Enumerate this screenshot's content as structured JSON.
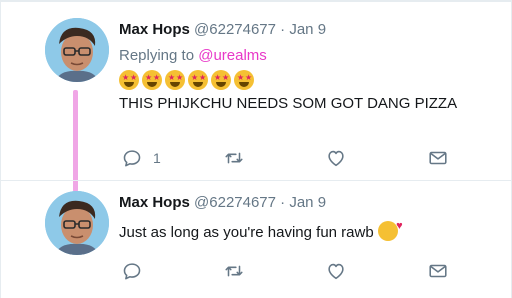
{
  "tweets": [
    {
      "author_name": "Max Hops",
      "author_handle": "@62274677",
      "separator": "·",
      "date": "Jan 9",
      "replying_prefix": "Replying to",
      "replying_to": "@urealms",
      "emoji_count": 6,
      "emoji_icon": "star-struck-emoji-icon",
      "text": "THIS PHIJKCHU NEEDS SOM GOT DANG PIZZA",
      "reply_count": "1"
    },
    {
      "author_name": "Max Hops",
      "author_handle": "@62274677",
      "separator": "·",
      "date": "Jan 9",
      "text": "Just as long as you're having fun rawb",
      "trailing_emoji_icon": "face-blowing-kiss-emoji-icon",
      "reply_count": ""
    }
  ],
  "colors": {
    "accent_mention": "#e838c8",
    "thread_line": "#f0a6e6",
    "muted": "#657786",
    "text": "#14171a"
  },
  "icons": {
    "reply": "reply-icon",
    "retweet": "retweet-icon",
    "like": "heart-icon",
    "message": "direct-message-icon"
  }
}
